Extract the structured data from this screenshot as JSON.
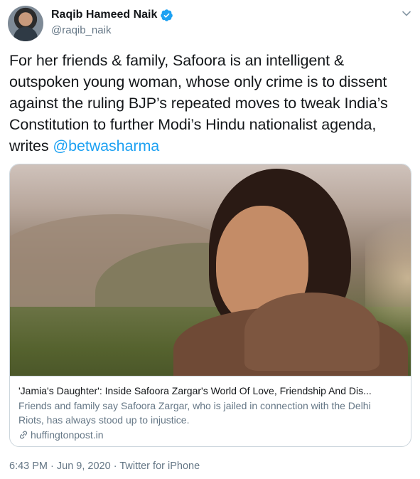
{
  "author": {
    "display_name": "Raqib Hameed Naik",
    "handle": "@raqib_naik"
  },
  "tweet": {
    "lines": [
      "For her friends & family, Safoora is an intelligent &",
      "outspoken young woman, whose only crime is to dissent",
      "against the ruling BJP’s repeated moves to tweak India’s",
      "Constitution to further Modi’s Hindu nationalist agenda,"
    ],
    "last_line_prefix": "writes ",
    "mention": "@betwasharma"
  },
  "card": {
    "title": "'Jamia's Daughter': Inside Safoora Zargar's World Of Love, Friendship And Dis...",
    "description_lines": [
      "Friends and family say Safoora Zargar, who is jailed in connection with the Delhi",
      "Riots, has always stood up to injustice."
    ],
    "domain": "huffingtonpost.in"
  },
  "meta": {
    "time": "6:43 PM",
    "separator": " · ",
    "date": "Jun 9, 2020",
    "source": "Twitter for iPhone"
  },
  "icons": {
    "verified": "verified-badge-icon",
    "chevron": "chevron-down-icon",
    "link": "link-icon"
  },
  "colors": {
    "accent": "#1da1f2",
    "text": "#14171a",
    "secondary": "#657786",
    "border": "#ccd6dd"
  }
}
